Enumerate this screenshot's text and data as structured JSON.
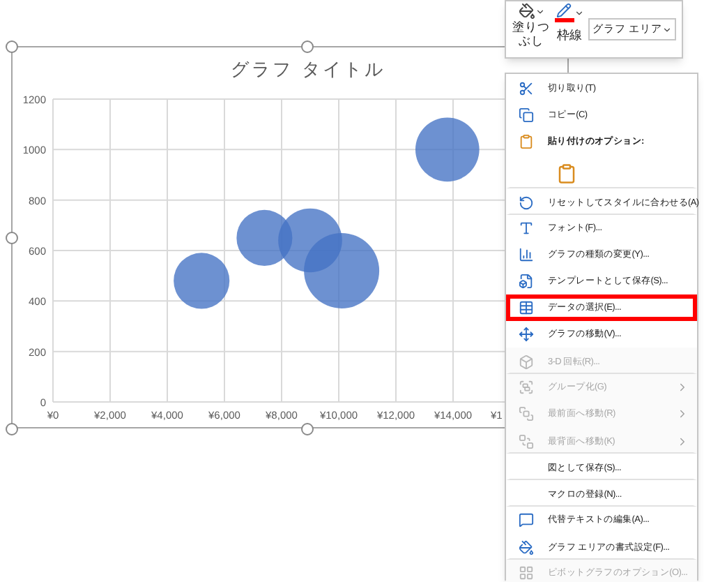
{
  "toolbar": {
    "fill_label": "塗りつぶし",
    "outline_label": "枠線",
    "element_dropdown": {
      "value": "グラフ エリア"
    }
  },
  "chart": {
    "chart_data": {
      "type": "scatter",
      "title": "グラフ タイトル",
      "xlim": [
        0,
        16000
      ],
      "ylim": [
        0,
        1200
      ],
      "grid": true,
      "xticks": [
        {
          "value": 0,
          "label": "¥0"
        },
        {
          "value": 2000,
          "label": "¥2,000"
        },
        {
          "value": 4000,
          "label": "¥4,000"
        },
        {
          "value": 6000,
          "label": "¥6,000"
        },
        {
          "value": 8000,
          "label": "¥8,000"
        },
        {
          "value": 10000,
          "label": "¥10,000"
        },
        {
          "value": 12000,
          "label": "¥12,000"
        },
        {
          "value": 14000,
          "label": "¥14,000"
        }
      ],
      "yticks": [
        0,
        200,
        400,
        600,
        800,
        1000,
        1200
      ],
      "series": [
        {
          "color": "#4472c4",
          "x": [
            5200,
            7400,
            9000,
            10100,
            13800
          ],
          "values": [
            480,
            650,
            640,
            520,
            1000
          ],
          "sizes": [
            0.55,
            0.55,
            0.72,
            1,
            0.72
          ]
        }
      ]
    },
    "cut_tick_label": "¥1"
  },
  "context_menu": {
    "items": [
      {
        "kind": "item",
        "label": "切り取り(T)",
        "disabled": false,
        "highlighted": false,
        "submenu": false,
        "separator_after": false
      },
      {
        "kind": "item",
        "label": "コピー(C)",
        "disabled": false,
        "highlighted": false,
        "submenu": false,
        "separator_after": false
      },
      {
        "kind": "header",
        "label": "貼り付けのオプション:",
        "disabled": false,
        "highlighted": false,
        "submenu": false,
        "separator_after": false
      },
      {
        "kind": "paste-option",
        "disabled": false,
        "highlighted": false,
        "submenu": false,
        "separator_after": true
      },
      {
        "kind": "item",
        "label": "リセットしてスタイルに合わせる(A)",
        "disabled": false,
        "highlighted": false,
        "submenu": false,
        "separator_after": true
      },
      {
        "kind": "item",
        "label": "フォント(F)...",
        "disabled": false,
        "highlighted": false,
        "submenu": false,
        "separator_after": false
      },
      {
        "kind": "item",
        "label": "グラフの種類の変更(Y)...",
        "disabled": false,
        "highlighted": false,
        "submenu": false,
        "separator_after": false
      },
      {
        "kind": "item",
        "label": "テンプレートとして保存(S)...",
        "disabled": false,
        "highlighted": false,
        "submenu": false,
        "separator_after": false
      },
      {
        "kind": "item",
        "label": "データの選択(E)...",
        "disabled": false,
        "highlighted": true,
        "submenu": false,
        "separator_after": false
      },
      {
        "kind": "item",
        "label": "グラフの移動(V)...",
        "disabled": false,
        "highlighted": false,
        "submenu": false,
        "separator_after": false
      },
      {
        "kind": "item",
        "label": "3-D 回転(R)...",
        "disabled": true,
        "highlighted": false,
        "submenu": false,
        "separator_after": true
      },
      {
        "kind": "item",
        "label": "グループ化(G)",
        "disabled": true,
        "highlighted": false,
        "submenu": true,
        "separator_after": false
      },
      {
        "kind": "item",
        "label": "最前面へ移動(R)",
        "disabled": true,
        "highlighted": false,
        "submenu": true,
        "separator_after": false
      },
      {
        "kind": "item",
        "label": "最背面へ移動(K)",
        "disabled": true,
        "highlighted": false,
        "submenu": true,
        "separator_after": true
      },
      {
        "kind": "item",
        "label": "図として保存(S)...",
        "disabled": false,
        "highlighted": false,
        "submenu": false,
        "separator_after": true
      },
      {
        "kind": "item",
        "label": "マクロの登録(N)...",
        "disabled": false,
        "highlighted": false,
        "submenu": false,
        "separator_after": true
      },
      {
        "kind": "item",
        "label": "代替テキストの編集(A)...",
        "disabled": false,
        "highlighted": false,
        "submenu": false,
        "separator_after": false
      },
      {
        "kind": "item",
        "label": "グラフ エリアの書式設定(F)...",
        "disabled": false,
        "highlighted": false,
        "submenu": false,
        "separator_after": true
      },
      {
        "kind": "item",
        "label": "ピボットグラフのオプション(O)...",
        "disabled": true,
        "highlighted": false,
        "submenu": false,
        "separator_after": false
      }
    ]
  }
}
